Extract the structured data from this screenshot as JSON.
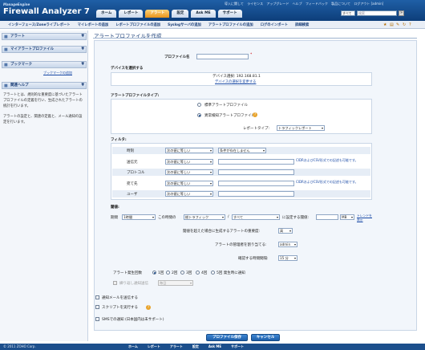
{
  "header": {
    "brand_small": "ManageEngine",
    "brand": "Firewall Analyzer 7",
    "top_links": [
      "導入に関して",
      "ライセンス",
      "アップグレード",
      "ヘルプ",
      "フィードバック",
      "製品について",
      "ログアウト [admin]"
    ],
    "tabs": [
      "ホーム",
      "レポート",
      "アラート",
      "設定",
      "Ask ME",
      "サポート"
    ],
    "search_select": "すべて",
    "search_label": "検索",
    "search_button": "»"
  },
  "subnav": {
    "items": [
      "インターフェース/Zoneライブレポート",
      "マイレポートの追加",
      "レポートプロファイルの追加",
      "Syslogサーバの追加",
      "アラートプロファイルの追加",
      "ログのインポート",
      "詳細検索"
    ]
  },
  "sidebar": {
    "alert": "アラート",
    "my_alert_profile": "マイアラートプロファイル",
    "bookmark": "ブックマーク",
    "bookmark_add": "ブックマークの追加",
    "help": "関連ヘルプ",
    "help_text_1": "アラートとは、規則的な重要度に基づいたアラートプロファイルの定義を行い、生成されたアラートの統計を行います。",
    "help_text_2": "アラートの設定と、関連の定義と、メール通知の設定を行います。"
  },
  "page": {
    "title": "アラートプロファイルを作成",
    "profile_name_label": "プロファイル名",
    "profile_name_value": "",
    "required_mark": "*",
    "device_section": "デバイスを選択する",
    "device_selected": "デバイス選択: 192.168.81.1",
    "device_change": "デバイスの選択を変更する",
    "alert_type_label": "アラートプロファイルタイプ:",
    "type_standard": "標準アラートプロファイル",
    "type_anomaly": "異常検知アラートプロファイル",
    "report_type_label": "レポートタイプ:",
    "report_type_value": "トラフィックレポート",
    "filter_label": "フィルタ:",
    "filter_rows": [
      {
        "name": "時刻",
        "op": "次の値に等しい",
        "value": "条件が存在しません",
        "hint": ""
      },
      {
        "name": "送信元",
        "op": "次の値に等しい",
        "value": "",
        "hint": "CIDRおよびCSV形式での記述も可能です。"
      },
      {
        "name": "プロトコル",
        "op": "次の値に等しい",
        "value": "",
        "hint": ""
      },
      {
        "name": "宛て先",
        "op": "次の値に等しい",
        "value": "",
        "hint": "CIDRおよびCSV形式での記述も可能です。"
      },
      {
        "name": "ユーザ",
        "op": "次の値に等しい",
        "value": "",
        "hint": ""
      }
    ],
    "threshold_label": "閾値:",
    "period_label": "期間",
    "period_value": "1時間",
    "in_period_text": "この時間の",
    "metric_value": "総トラフィック",
    "slash": "/",
    "scope_value": "すべて",
    "threshold_text": "に設定する閾値:",
    "threshold_value": "",
    "unit_value": "MB",
    "trend_link": "トレンドを表示",
    "severity_label": "閾値を超えた場合に生成するアラートの重要度:",
    "severity_value": "高",
    "assign_label": "アラートの管理者を割り当てる:",
    "assign_value": "admin",
    "interval_label": "確認する時間間隔:",
    "interval_value": "15 分",
    "count_label": "アラート発生回数",
    "counts": [
      "1回",
      "2回",
      "3回",
      "4回",
      "5回 発生時に通知"
    ],
    "repeat_label": "繰り返し通知送信",
    "repeat_value": "毎日",
    "email_label": "通知メールを送信する",
    "script_label": "スクリプトを実行する",
    "sms_label": "SMSでの通知 (日本国内は未サポート)",
    "save_button": "プロファイル保存",
    "cancel_button": "キャンセル"
  },
  "footer": {
    "copyright": "© 2011 ZOHO Corp.",
    "links": [
      "ホーム",
      "レポート",
      "アラート",
      "設定",
      "Ask ME",
      "サポート"
    ]
  }
}
